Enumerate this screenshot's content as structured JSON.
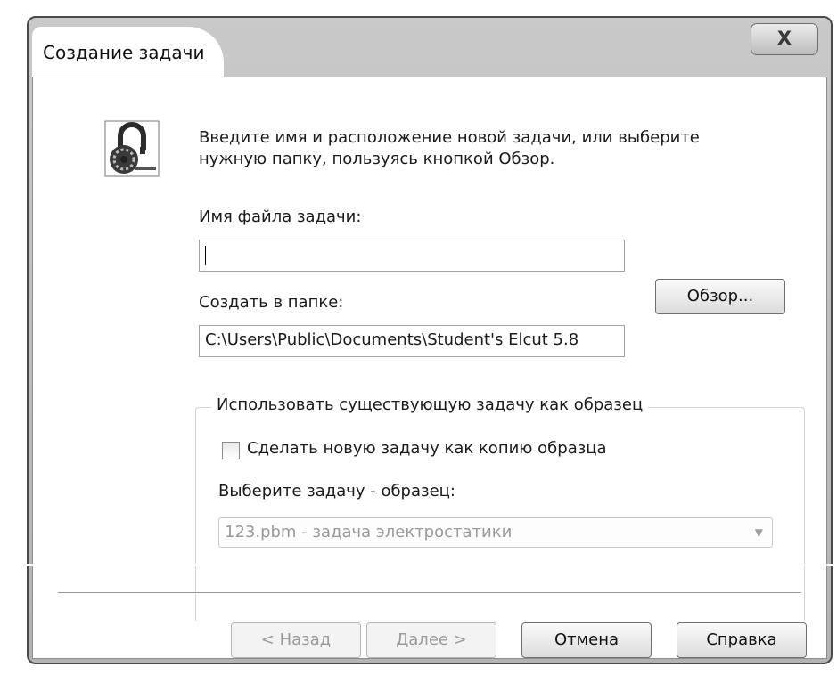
{
  "window": {
    "title": "Создание задачи",
    "close_label": "X"
  },
  "intro_text": "Введите имя и расположение новой задачи, или выберите нужную папку, пользуясь кнопкой Обзор.",
  "form": {
    "filename_label": "Имя файла задачи:",
    "filename_value": "",
    "folder_label": "Создать в папке:",
    "folder_value": "C:\\Users\\Public\\Documents\\Student's Elcut 5.8",
    "browse_label": "Обзор..."
  },
  "template_group": {
    "legend": "Использовать существующую задачу как образец",
    "copy_checkbox_label": "Сделать новую задачу как копию образца",
    "copy_checked": false,
    "select_label": "Выберите задачу - образец:",
    "select_value": "123.pbm - задача электростатики"
  },
  "buttons": {
    "back": "< Назад",
    "next": "Далее >",
    "cancel": "Отмена",
    "help": "Справка"
  }
}
